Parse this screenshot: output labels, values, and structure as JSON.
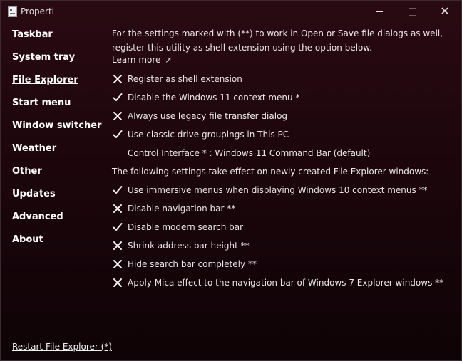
{
  "window": {
    "title": "Properti"
  },
  "sidebar": {
    "items": [
      {
        "label": "Taskbar",
        "active": false
      },
      {
        "label": "System tray",
        "active": false
      },
      {
        "label": "File Explorer",
        "active": true
      },
      {
        "label": "Start menu",
        "active": false
      },
      {
        "label": "Window switcher",
        "active": false
      },
      {
        "label": "Weather",
        "active": false
      },
      {
        "label": "Other",
        "active": false
      },
      {
        "label": "Updates",
        "active": false
      },
      {
        "label": "Advanced",
        "active": false
      },
      {
        "label": "About",
        "active": false
      }
    ],
    "restart_label": "Restart File Explorer (*)"
  },
  "content": {
    "intro": "For the settings marked with (**) to work in Open or Save file dialogs as well, register this utility as shell extension using the option below.",
    "learn_more": "Learn more",
    "learn_more_arrow": "↗",
    "options_top": [
      {
        "label": "Register as shell extension",
        "checked": false
      },
      {
        "label": "Disable the Windows 11 context menu *",
        "checked": true
      },
      {
        "label": "Always use legacy file transfer dialog",
        "checked": false
      },
      {
        "label": "Use classic drive groupings in This PC",
        "checked": true
      }
    ],
    "control_interface": "Control Interface * : Windows 11 Command Bar (default)",
    "section_note": "The following settings take effect on newly created File Explorer windows:",
    "options_bottom": [
      {
        "label": "Use immersive menus when displaying Windows 10 context menus **",
        "checked": true
      },
      {
        "label": "Disable navigation bar **",
        "checked": false
      },
      {
        "label": "Disable modern search bar",
        "checked": true
      },
      {
        "label": "Shrink address bar height **",
        "checked": false
      },
      {
        "label": "Hide search bar completely **",
        "checked": false
      },
      {
        "label": "Apply Mica effect to the navigation bar of Windows 7 Explorer windows **",
        "checked": false
      }
    ]
  },
  "icons": {
    "checked": "check-icon",
    "unchecked": "cross-icon"
  }
}
